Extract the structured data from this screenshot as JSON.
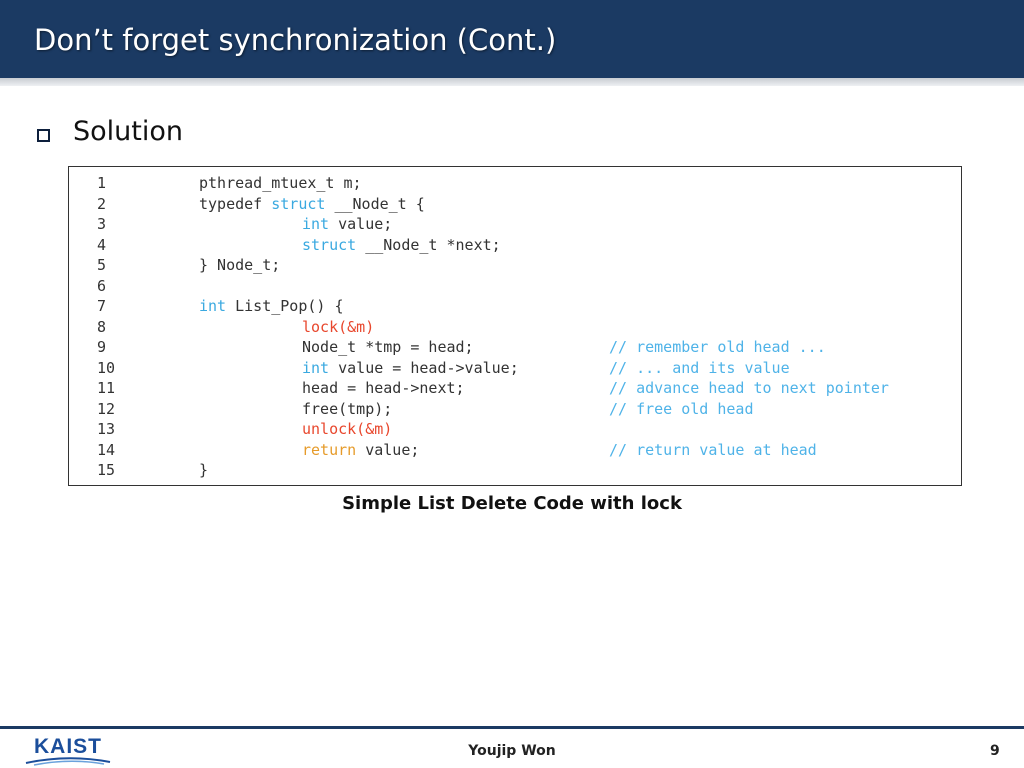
{
  "slide": {
    "title": "Don’t forget synchronization (Cont.)",
    "heading": "Solution",
    "caption": "Simple List Delete Code with lock"
  },
  "code": {
    "lines": [
      {
        "num": "1",
        "indent": 1,
        "segments": [
          {
            "t": "pthread_mtuex_t m;",
            "c": "plain"
          }
        ],
        "comment": ""
      },
      {
        "num": "2",
        "indent": 1,
        "segments": [
          {
            "t": "typedef ",
            "c": "plain"
          },
          {
            "t": "struct",
            "c": "keyword"
          },
          {
            "t": " __Node_t {",
            "c": "plain"
          }
        ],
        "comment": ""
      },
      {
        "num": "3",
        "indent": 2,
        "segments": [
          {
            "t": "int",
            "c": "keyword"
          },
          {
            "t": " value;",
            "c": "plain"
          }
        ],
        "comment": ""
      },
      {
        "num": "4",
        "indent": 2,
        "segments": [
          {
            "t": "struct",
            "c": "keyword"
          },
          {
            "t": " __Node_t *next;",
            "c": "plain"
          }
        ],
        "comment": ""
      },
      {
        "num": "5",
        "indent": 1,
        "segments": [
          {
            "t": "} Node_t;",
            "c": "plain"
          }
        ],
        "comment": ""
      },
      {
        "num": "6",
        "indent": 1,
        "segments": [],
        "comment": ""
      },
      {
        "num": "7",
        "indent": 1,
        "segments": [
          {
            "t": "int",
            "c": "keyword"
          },
          {
            "t": " List_Pop() {",
            "c": "plain"
          }
        ],
        "comment": ""
      },
      {
        "num": "8",
        "indent": 2,
        "segments": [
          {
            "t": "lock(&m)",
            "c": "lock"
          }
        ],
        "comment": ""
      },
      {
        "num": "9",
        "indent": 2,
        "segments": [
          {
            "t": "Node_t *tmp = head;",
            "c": "plain"
          }
        ],
        "comment": "// remember old head ..."
      },
      {
        "num": "10",
        "indent": 2,
        "segments": [
          {
            "t": "int",
            "c": "keyword"
          },
          {
            "t": " value = head->value;",
            "c": "plain"
          }
        ],
        "comment": "// ... and its value"
      },
      {
        "num": "11",
        "indent": 2,
        "segments": [
          {
            "t": "head = head->next;",
            "c": "plain"
          }
        ],
        "comment": "// advance head to next pointer"
      },
      {
        "num": "12",
        "indent": 2,
        "segments": [
          {
            "t": "free(tmp);",
            "c": "plain"
          }
        ],
        "comment": "// free old head"
      },
      {
        "num": "13",
        "indent": 2,
        "segments": [
          {
            "t": "unlock(&m)",
            "c": "lock"
          }
        ],
        "comment": ""
      },
      {
        "num": "14",
        "indent": 2,
        "segments": [
          {
            "t": "return",
            "c": "return"
          },
          {
            "t": " value;",
            "c": "plain"
          }
        ],
        "comment": "// return value at head"
      },
      {
        "num": "15",
        "indent": 1,
        "segments": [
          {
            "t": "}",
            "c": "plain"
          }
        ],
        "comment": ""
      }
    ]
  },
  "footer": {
    "logo_text": "KAIST",
    "author": "Youjip Won",
    "page_number": "9"
  },
  "colors": {
    "header_bg": "#1b3a63",
    "keyword": "#3aa9e0",
    "lock_call": "#e8472d",
    "return_kw": "#e69b2a",
    "comment": "#4fb3e8",
    "logo": "#1b4e9b"
  },
  "icons": {
    "bullet": "hollow-square-bullet-icon"
  }
}
